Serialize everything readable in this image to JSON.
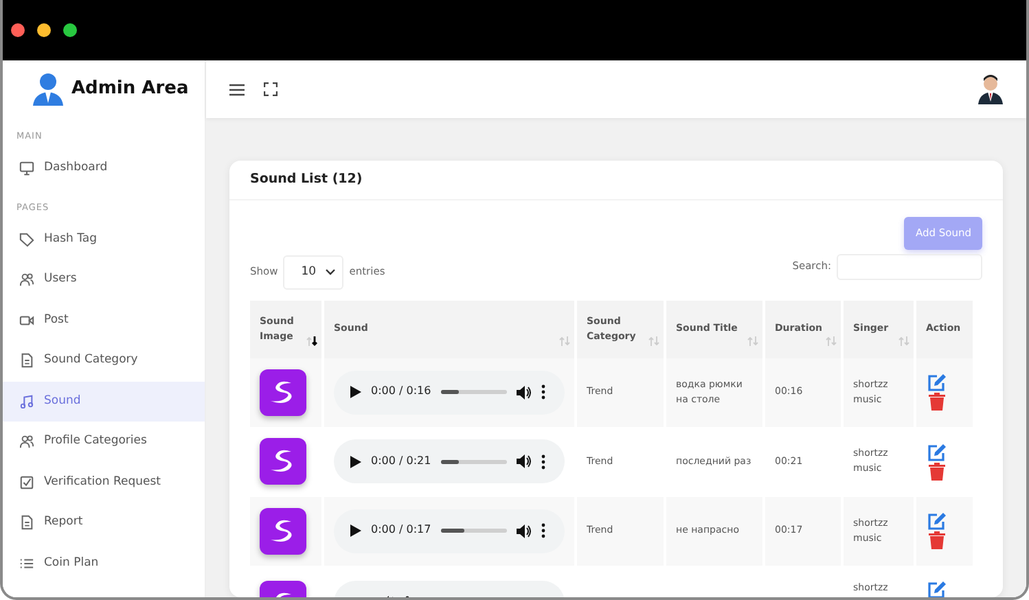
{
  "brand": {
    "title": "Admin Area"
  },
  "sidebar": {
    "sections": [
      {
        "heading": "MAIN",
        "items": [
          {
            "label": "Dashboard",
            "kind": "monitor",
            "selected": false
          }
        ]
      },
      {
        "heading": "PAGES",
        "items": [
          {
            "label": "Hash Tag",
            "kind": "tag",
            "selected": false
          },
          {
            "label": "Users",
            "kind": "users",
            "selected": false
          },
          {
            "label": "Post",
            "kind": "video",
            "selected": false
          },
          {
            "label": "Sound Category",
            "kind": "file",
            "selected": false
          },
          {
            "label": "Sound",
            "kind": "music",
            "selected": true
          },
          {
            "label": "Profile Categories",
            "kind": "users",
            "selected": false
          },
          {
            "label": "Verification Request",
            "kind": "check",
            "selected": false
          },
          {
            "label": "Report",
            "kind": "file",
            "selected": false
          },
          {
            "label": "Coin Plan",
            "kind": "list",
            "selected": false
          }
        ]
      }
    ]
  },
  "card": {
    "title": "Sound List (12)",
    "add_button": "Add Sound",
    "length": {
      "before": "Show",
      "value": "10",
      "after": "entries"
    },
    "search": {
      "label": "Search:"
    }
  },
  "table": {
    "columns": [
      {
        "label": "Sound Image",
        "sortable": true,
        "sorted": true
      },
      {
        "label": "Sound",
        "sortable": true,
        "sorted": false
      },
      {
        "label": "Sound Category",
        "sortable": true,
        "sorted": false
      },
      {
        "label": "Sound Title",
        "sortable": true,
        "sorted": false
      },
      {
        "label": "Duration",
        "sortable": true,
        "sorted": false
      },
      {
        "label": "Singer",
        "sortable": true,
        "sorted": false
      },
      {
        "label": "Action",
        "sortable": false
      }
    ],
    "rows": [
      {
        "time": "0:00 / 0:16",
        "level": 0.27,
        "category": "Trend",
        "title": "водка рюмки на столе",
        "duration": "00:16",
        "singer": "shortzz music"
      },
      {
        "time": "0:00 / 0:21",
        "level": 0.27,
        "category": "Trend",
        "title": "последний раз",
        "duration": "00:21",
        "singer": "shortzz music"
      },
      {
        "time": "0:00 / 0:17",
        "level": 0.35,
        "category": "Trend",
        "title": "не напрасно",
        "duration": "00:17",
        "singer": "shortzz music"
      },
      {
        "singer": "shortzz"
      }
    ]
  }
}
